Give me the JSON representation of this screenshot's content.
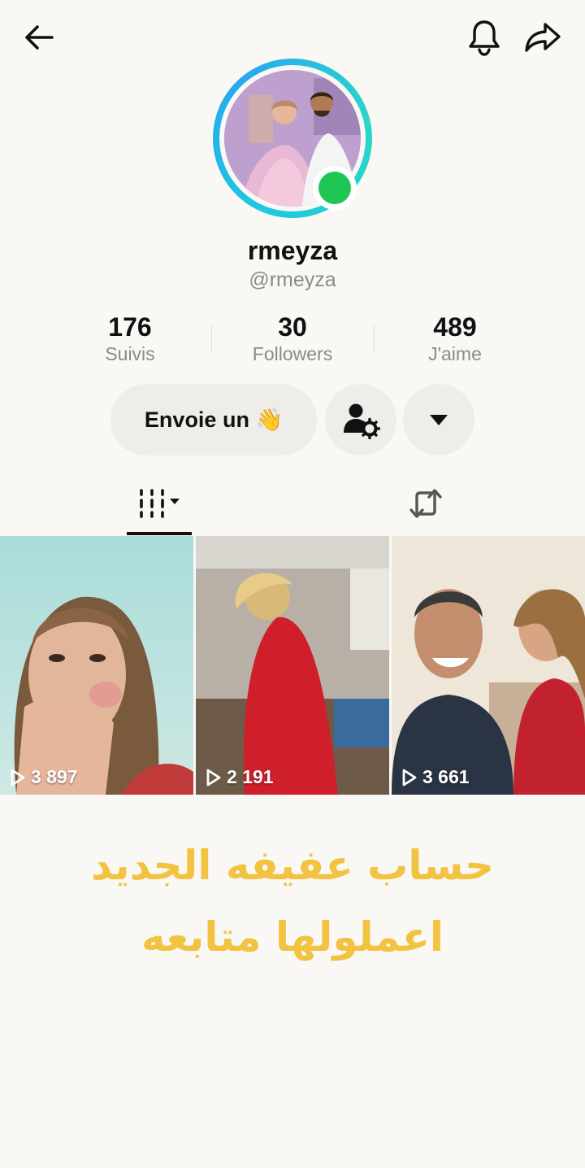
{
  "profile": {
    "display_name": "rmeyza",
    "handle": "@rmeyza",
    "online": true
  },
  "stats": [
    {
      "value": "176",
      "label": "Suivis"
    },
    {
      "value": "30",
      "label": "Followers"
    },
    {
      "value": "489",
      "label": "J'aime"
    }
  ],
  "actions": {
    "message_label": "Envoie un 👋"
  },
  "icons": {
    "back": "arrow-left-icon",
    "notifications": "bell-icon",
    "share": "share-arrow-icon",
    "add_friend_settings": "person-gear-icon",
    "more": "caret-down-icon",
    "videos_tab": "video-grid-icon",
    "reposts_tab": "repost-icon",
    "play": "play-icon"
  },
  "videos": [
    {
      "views": "3 897"
    },
    {
      "views": "2 191"
    },
    {
      "views": "3 661"
    }
  ],
  "caption": "حساب عفيفه الجديد اعملولها متابعه",
  "colors": {
    "background": "#faf8f5",
    "caption": "#f2c340",
    "online": "#20c653",
    "ring": "#1ec8e0"
  }
}
